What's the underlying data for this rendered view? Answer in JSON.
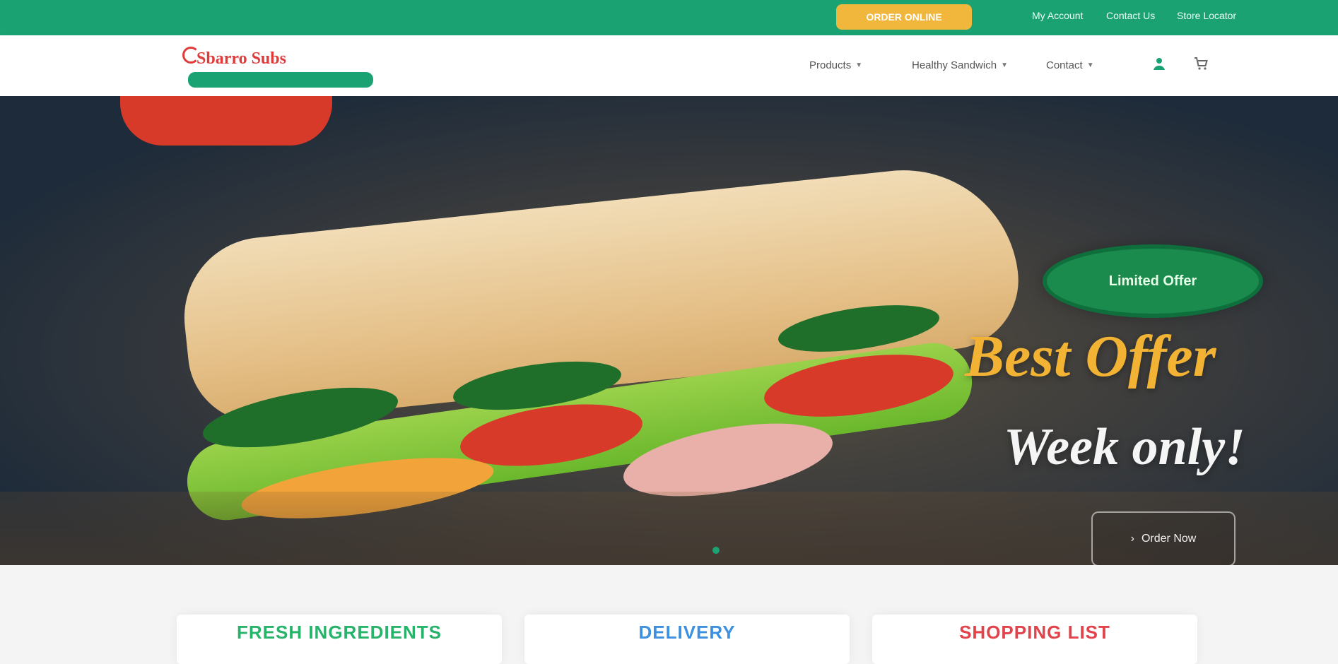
{
  "topbar": {
    "promo_label": "ORDER ONLINE",
    "links": [
      "My Account",
      "Contact Us",
      "Store Locator"
    ]
  },
  "header": {
    "logo_text": "Sbarro Subs",
    "nav": [
      {
        "label": "Products"
      },
      {
        "label": "Healthy Sandwich"
      },
      {
        "label": "Contact"
      }
    ],
    "icons": [
      "user-icon",
      "cart-icon"
    ]
  },
  "hero": {
    "badge_text": "Limited Offer",
    "headline": "Best Offer",
    "subline": "Week only!",
    "cta_label": "Order Now"
  },
  "cards": [
    {
      "title": "FRESH INGREDIENTS",
      "color": "#27b36a"
    },
    {
      "title": "DELIVERY",
      "color": "#3d8fe0"
    },
    {
      "title": "SHOPPING LIST",
      "color": "#e2424a"
    }
  ],
  "colors": {
    "green": "#1aa272",
    "promo_yellow": "#f0b73c",
    "headline_gold": "#f2b233"
  }
}
